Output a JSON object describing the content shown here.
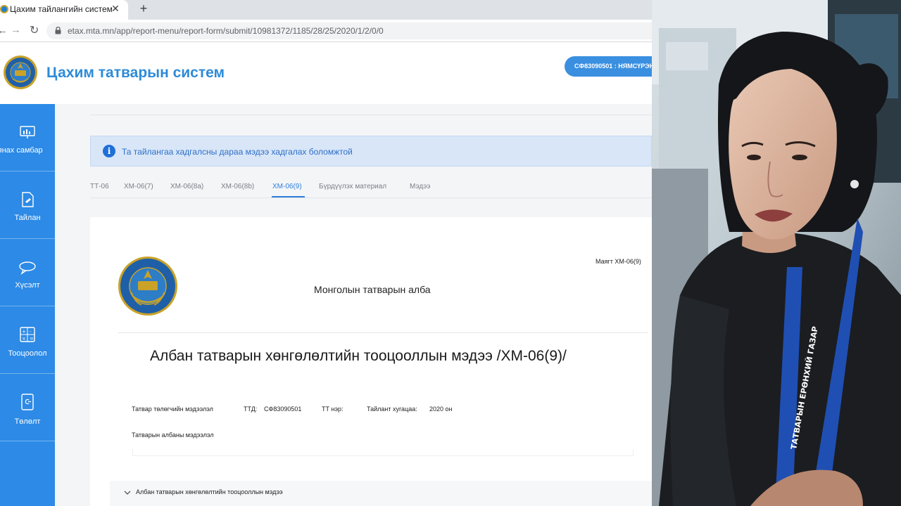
{
  "browser": {
    "tab_title": "Цахим тайлангийн систем",
    "tab_close": "✕",
    "new_tab": "+",
    "url": "etax.mta.mn/app/report-menu/report-form/submit/10981372/1185/28/25/2020/1/2/0/0"
  },
  "header": {
    "app_title": "Цахим татварын систем",
    "user_badge": "СФ83090501 : НЯМСҮРЭН"
  },
  "sidebar": {
    "items": [
      {
        "label": "Хянах самбар",
        "icon": "dashboard-icon"
      },
      {
        "label": "Тайлан",
        "icon": "report-icon"
      },
      {
        "label": "Хүсэлт",
        "icon": "chat-icon"
      },
      {
        "label": "Тооцоолол",
        "icon": "calculator-icon"
      },
      {
        "label": "Төлөлт",
        "icon": "payment-icon"
      }
    ]
  },
  "alert": {
    "icon": "i",
    "text": "Та тайлангаа хадгалсны дараа мэдээ хадгалах боломжтой"
  },
  "report_tabs": [
    "ТТ-06",
    "ХМ-06(7)",
    "ХМ-06(8a)",
    "ХМ-06(8b)",
    "ХМ-06(9)",
    "Бүрдүүлэх материал",
    "Мэдээ"
  ],
  "active_tab": "ХМ-06(9)",
  "document": {
    "form_code": "Маягт ХМ-06(9)",
    "org_name": "Монголын татварын алба",
    "title": "Албан татварын хөнгөлөлтийн тооцооллын мэдээ /ХМ-06(9)/",
    "taxpayer_label": "Татвар төлөгчийн мэдээлэл",
    "ttd_label": "ТТД:",
    "ttd_value": "СФ83090501",
    "tt_name_label": "ТТ нэр:",
    "period_label": "Тайлант хугацаа:",
    "period_value": "2020 он",
    "office_label": "Татварын албаны мэдээлэл",
    "section_title": "Албан татварын хөнгөлөлтийн тооцооллын мэдээ"
  },
  "photo": {
    "lanyard_text": "ТАТВАРЫН ЕРӨНХИЙ ГАЗАР"
  },
  "colors": {
    "accent": "#2d8ae6",
    "title": "#2d8bd8",
    "alert_bg": "#d8e6f8"
  }
}
